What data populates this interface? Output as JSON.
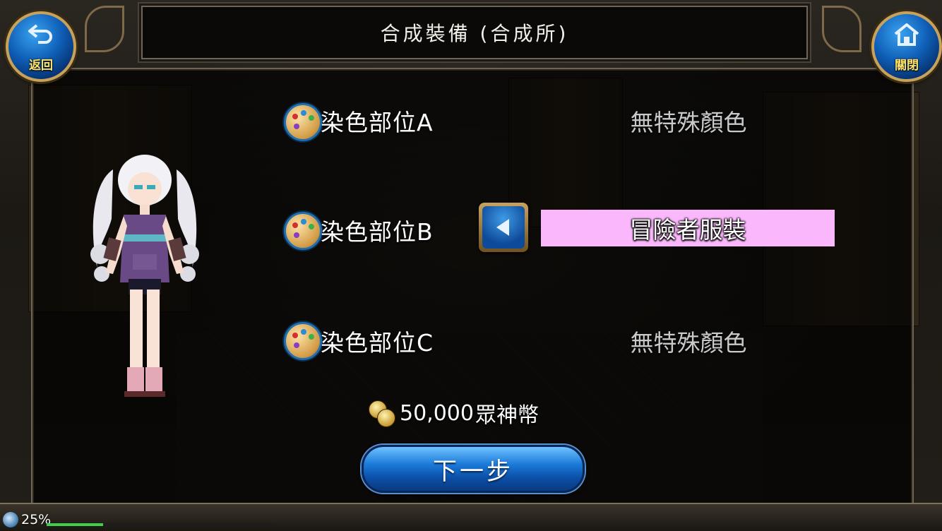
{
  "header": {
    "title": "合成裝備 (合成所)"
  },
  "nav": {
    "back_label": "返回",
    "back_icon": "return-arrow-icon",
    "close_label": "關閉",
    "close_icon": "home-icon"
  },
  "dye_rows": [
    {
      "label": "染色部位A",
      "value": "無特殊顏色"
    },
    {
      "label": "染色部位B",
      "value": "冒險者服裝"
    },
    {
      "label": "染色部位C",
      "value": "無特殊顏色"
    }
  ],
  "selected_row_highlight_color": "#fbb7fb",
  "cost": {
    "amount": "50,000",
    "currency": "眾神幣"
  },
  "next_button": {
    "label": "下一步"
  },
  "loading": {
    "percent_label": "25%",
    "progress": 0.25
  }
}
